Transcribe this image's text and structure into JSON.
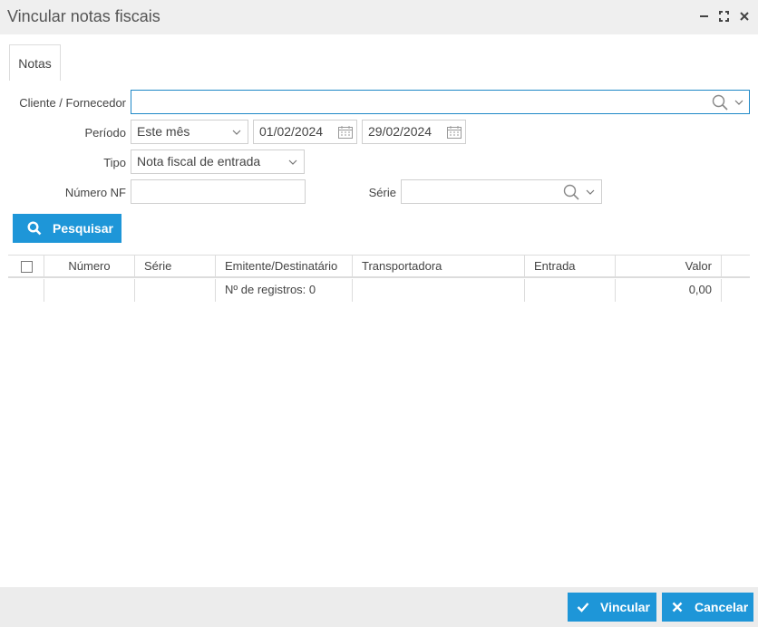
{
  "window": {
    "title": "Vincular notas fiscais"
  },
  "tabs": [
    {
      "label": "Notas"
    }
  ],
  "form": {
    "cliente_label": "Cliente / Fornecedor",
    "cliente_value": "",
    "periodo_label": "Período",
    "periodo_value": "Este mês",
    "date_start": "01/02/2024",
    "date_end": "29/02/2024",
    "tipo_label": "Tipo",
    "tipo_value": "Nota fiscal de entrada",
    "numero_label": "Número NF",
    "numero_value": "",
    "serie_label": "Série",
    "serie_value": "",
    "search_button": "Pesquisar"
  },
  "grid": {
    "columns": [
      "Número",
      "Série",
      "Emitente/Destinatário",
      "Transportadora",
      "Entrada",
      "Valor"
    ],
    "summary": {
      "registros": "Nº de registros: 0",
      "valor_total": "0,00"
    }
  },
  "footer": {
    "vincular": "Vincular",
    "cancelar": "Cancelar"
  },
  "colors": {
    "accent": "#1e96d8",
    "focus_border": "#1e88c7",
    "titlebar": "#efefef"
  },
  "icons": [
    "minimize-icon",
    "maximize-icon",
    "close-icon",
    "search-icon",
    "chevron-down-icon",
    "calendar-icon",
    "check-icon",
    "x-icon"
  ]
}
